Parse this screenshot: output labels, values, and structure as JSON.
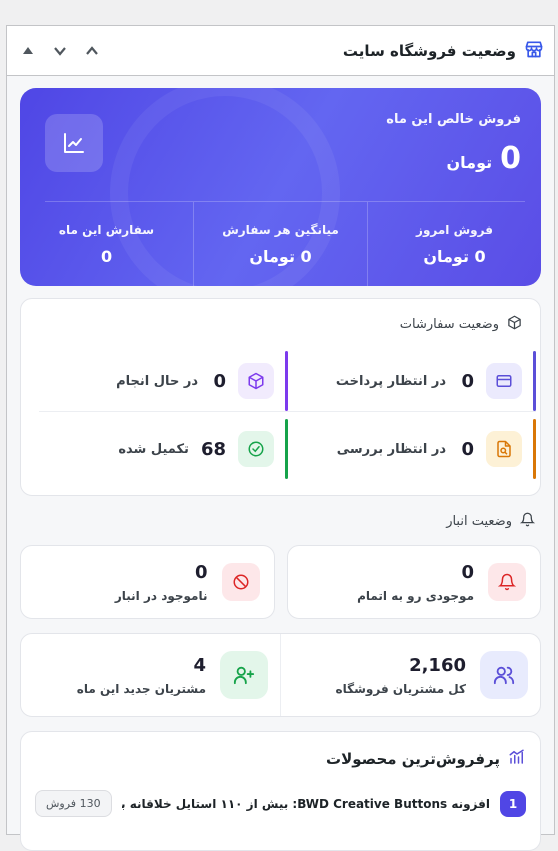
{
  "header": {
    "title": "وضعیت فروشگاه سایت",
    "icon": "store-icon",
    "controls": [
      "chevron-up-icon",
      "chevron-down-icon",
      "arrow-up-icon"
    ]
  },
  "hero": {
    "label": "فروش خالص این ماه",
    "value": "0",
    "unit": "تومان",
    "icon": "chart-line-icon",
    "stats": [
      {
        "label": "فروش امروز",
        "value": "0 تومان"
      },
      {
        "label": "میانگین هر سفارش",
        "value": "0 تومان"
      },
      {
        "label": "سفارش این ماه",
        "value": "0"
      }
    ]
  },
  "orders": {
    "title": "وضعیت سفارشات",
    "items": [
      {
        "label": "در انتظار پرداخت",
        "count": "0",
        "icon": "credit-card-icon",
        "color": "#5b4fd8"
      },
      {
        "label": "در حال انجام",
        "count": "0",
        "icon": "box-icon",
        "color": "#7c3aed"
      },
      {
        "label": "در انتظار بررسی",
        "count": "0",
        "icon": "file-search-icon",
        "color": "#d97706"
      },
      {
        "label": "تکمیل شده",
        "count": "68",
        "icon": "check-circle-icon",
        "color": "#16a34a"
      }
    ]
  },
  "inventory": {
    "title": "وضعیت انبار",
    "items": [
      {
        "label": "موجودی رو به اتمام",
        "count": "0",
        "icon": "bell-icon"
      },
      {
        "label": "ناموجود در انبار",
        "count": "0",
        "icon": "ban-icon"
      }
    ]
  },
  "customers": {
    "items": [
      {
        "label": "کل مشتریان فروشگاه",
        "count": "2,160",
        "icon": "users-icon"
      },
      {
        "label": "مشتریان جدید این ماه",
        "count": "4",
        "icon": "user-plus-icon"
      }
    ]
  },
  "top_products": {
    "title": "پرفروش‌ترین محصولات",
    "items": [
      {
        "rank": "1",
        "name": "افزونه BWD Creative Buttons: بیش از ۱۱۰ استایل خلاقانه بر...",
        "sales": "130 فروش"
      }
    ]
  }
}
